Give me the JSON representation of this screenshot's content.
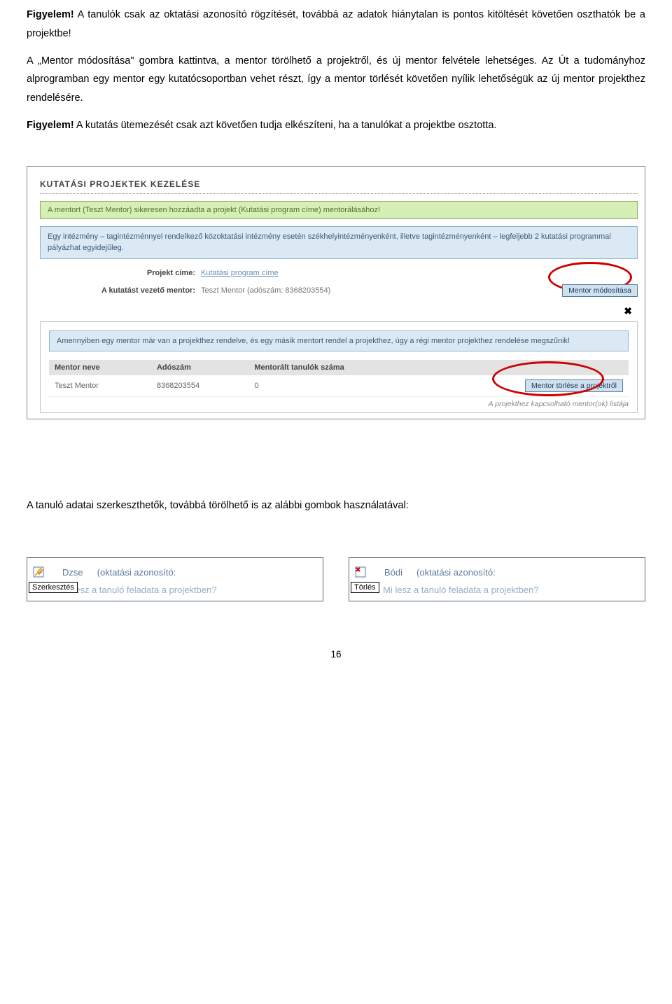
{
  "para1": {
    "bold": "Figyelem!",
    "text": " A tanulók csak az oktatási azonosító rögzítését, továbbá az adatok hiánytalan is pontos kitöltését követően oszthatók be a projektbe!"
  },
  "para2": "A „Mentor módosítása\" gombra kattintva, a mentor törölhető a projektről, és új mentor felvétele lehetséges. Az Út a tudományhoz alprogramban egy mentor egy kutatócsoportban vehet részt, így a mentor törlését követően nyílik lehetőségük az új mentor projekthez rendelésére.",
  "para3": {
    "bold": "Figyelem!",
    "text": " A kutatás ütemezését csak azt követően tudja elkészíteni, ha a tanulókat a projektbe osztotta."
  },
  "panel": {
    "title": "KUTATÁSI PROJEKTEK KEZELÉSE",
    "success": "A mentort (Teszt Mentor) sikeresen hozzáadta a projekt (Kutatási program címe) mentorálásához!",
    "info1": "Egy intézmény – tagintézménnyel rendelkező közoktatási intézmény esetén székhelyintézményenként, illetve tagintézményenként – legfeljebb 2 kutatási programmal pályázhat egyidejűleg.",
    "row1": {
      "label": "Projekt címe:",
      "value": "Kutatási program címe"
    },
    "row2": {
      "label": "A kutatást vezető mentor:",
      "value": "Teszt Mentor (adószám: 8368203554)"
    },
    "btn_modify": "Mentor módosítása",
    "close": "✖",
    "info2": "Amennyiben egy mentor már van a projekthez rendelve, és egy másik mentort rendel a projekthez, úgy a régi mentor projekthez rendelése megszűnik!",
    "table": {
      "headers": [
        "Mentor neve",
        "Adószám",
        "Mentorált tanulók száma",
        ""
      ],
      "row": [
        "Teszt Mentor",
        "8368203554",
        "0"
      ],
      "btn_delete": "Mentor törlése a projektről"
    },
    "footer": "A projekthez kapcsolható mentor(ok) listája"
  },
  "para4": "A tanuló adatai szerkeszthetők, továbbá törölhető is az alábbi gombok használatával:",
  "editBoxes": {
    "left": {
      "name": "Dzse",
      "paren": "(oktatási azonosító:",
      "btn": "Szerkesztés",
      "task": "Mi lesz a tanuló feladata a projektben?"
    },
    "right": {
      "name": "Bódi",
      "paren": "(oktatási azonosító:",
      "btn": "Törlés",
      "task": "Mi lesz a tanuló feladata a projektben?"
    }
  },
  "pageNumber": "16"
}
